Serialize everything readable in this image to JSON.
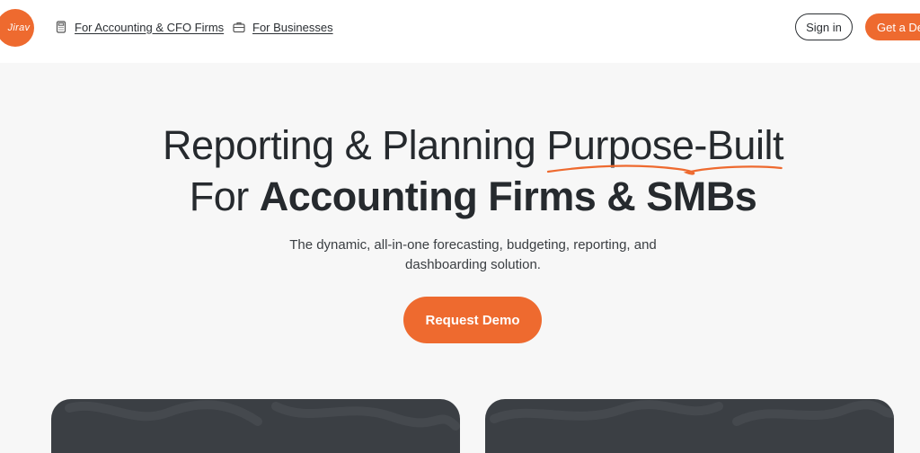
{
  "header": {
    "logo_text": "Jirav",
    "nav": [
      {
        "label": "For Accounting & CFO Firms",
        "icon": "calculator-icon"
      },
      {
        "label": "For Businesses",
        "icon": "briefcase-icon"
      }
    ],
    "signin_label": "Sign in",
    "demo_label": "Get a Demo"
  },
  "hero": {
    "line1_pre": "Reporting & Planning ",
    "line1_highlight": "Purpose-Built",
    "line2_pre": "For ",
    "line2_bold": "Accounting Firms & SMBs",
    "subtitle_1": "The dynamic, all-in-one forecasting, budgeting, reporting, and",
    "subtitle_2": "dashboarding solution.",
    "cta_label": "Request Demo"
  },
  "colors": {
    "accent": "#ee6a2f",
    "text": "#262a2e",
    "background": "#f7f7f7",
    "card": "#3b3f44"
  }
}
